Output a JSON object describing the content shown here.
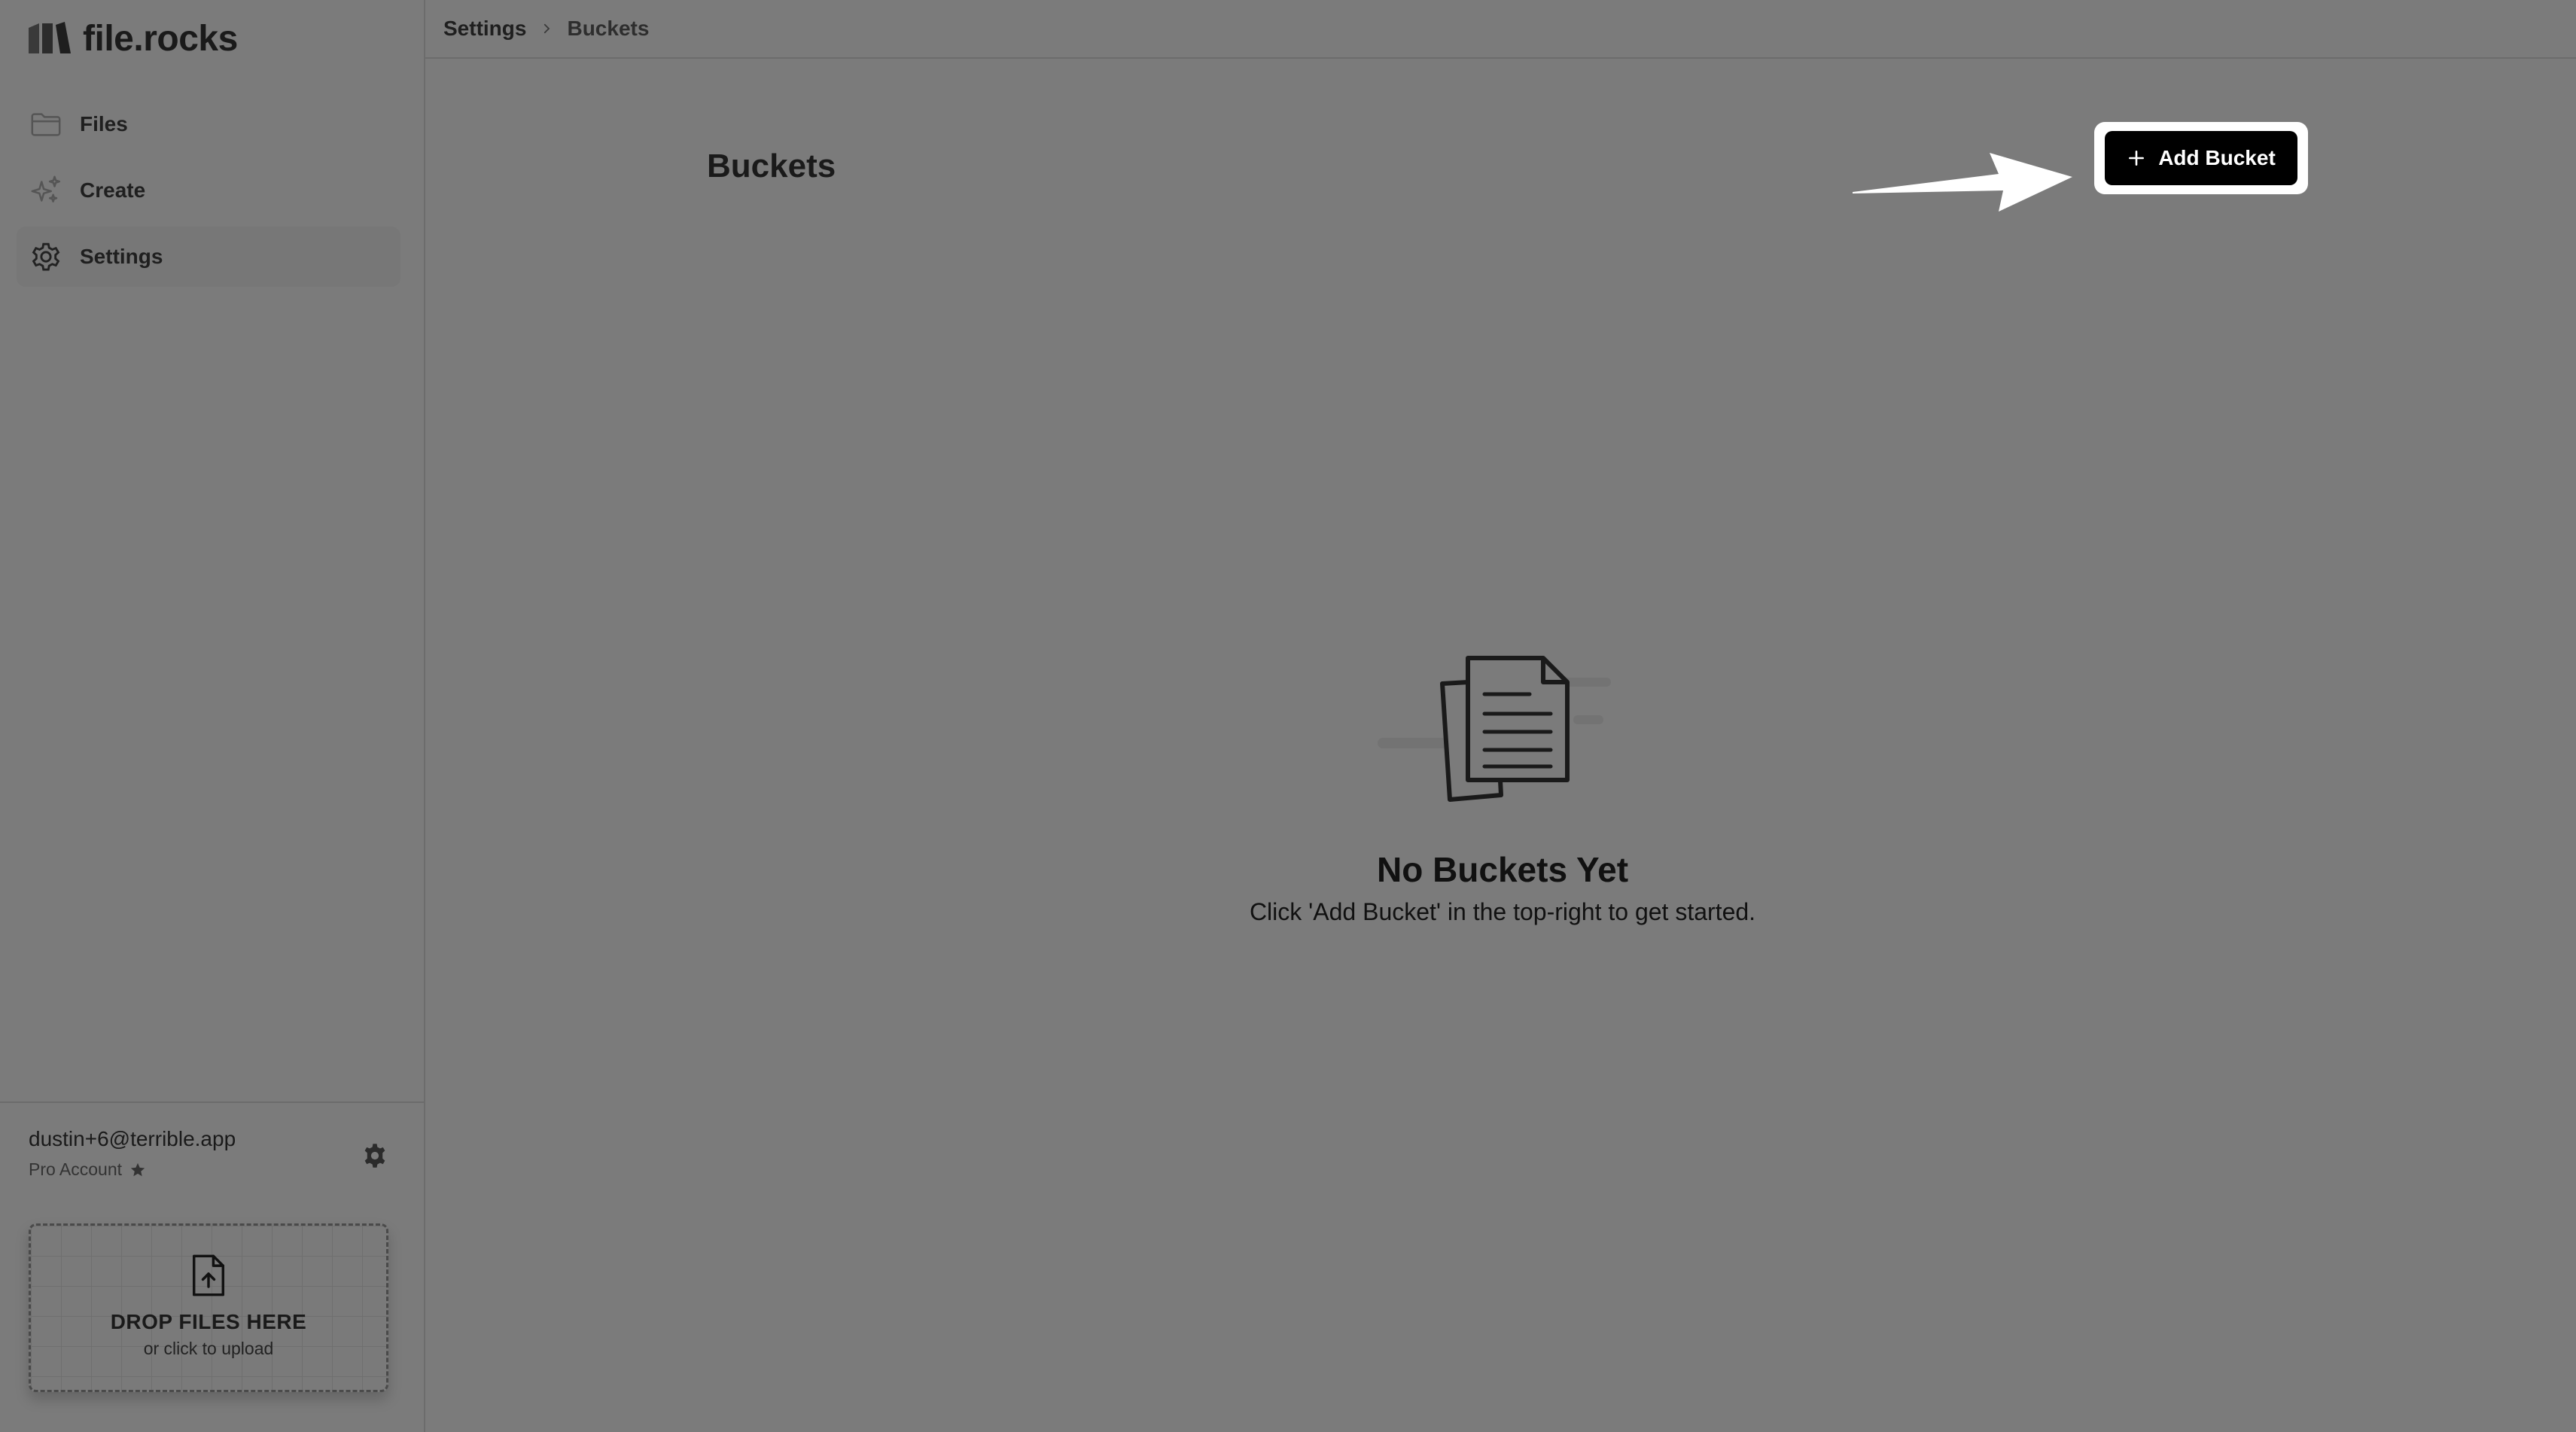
{
  "app": {
    "name": "file.rocks"
  },
  "sidebar": {
    "items": [
      {
        "label": "Files",
        "icon": "folder-icon"
      },
      {
        "label": "Create",
        "icon": "sparkles-icon"
      },
      {
        "label": "Settings",
        "icon": "gear-icon",
        "active": true
      }
    ]
  },
  "account": {
    "email": "dustin+6@terrible.app",
    "plan": "Pro Account",
    "plan_icon": "star-icon",
    "settings_icon": "gear-icon"
  },
  "dropzone": {
    "icon": "file-upload-icon",
    "title": "DROP FILES HERE",
    "subtitle": "or click to upload"
  },
  "breadcrumb": {
    "items": [
      "Settings",
      "Buckets"
    ],
    "separator_icon": "chevron-right-icon"
  },
  "main": {
    "title": "Buckets",
    "add_button": {
      "label": "Add Bucket",
      "icon": "plus-icon"
    },
    "annotation_icon": "arrow-right-icon",
    "empty_state": {
      "icon": "documents-icon",
      "title": "No Buckets Yet",
      "message": "Click 'Add Bucket' in the top-right to get started."
    }
  },
  "colors": {
    "background": "#7b7b7b",
    "button_bg": "#000000",
    "button_highlight": "#ffffff",
    "text": "#111111"
  }
}
